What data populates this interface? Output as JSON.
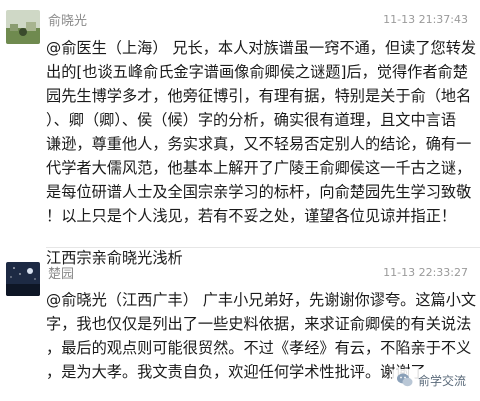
{
  "messages": [
    {
      "sender": "俞晓光",
      "time": "11-13 21:37:43",
      "avatar_icon": "landscape-avatar-icon",
      "lines": [
        "@俞医生（上海） 兄长，本人对族谱虽一窍不通，但读了您转发",
        "出的[也谈五峰俞氏金字谱画像俞卿侯之谜题]后，觉得作者俞楚",
        "园先生博学多才，他旁征博引，有理有据，特别是关于俞（地名",
        "）、卿（卿）、侯（候）字的分析，确实很有道理，且文中言语",
        "谦逊，尊重他人，务实求真，又不轻易否定别人的结论，确有一",
        "代学者大儒风范，他基本上解开了广陵王俞卿侯这一千古之谜，",
        "是每位研谱人士及全国宗亲学习的标杆，向俞楚园先生学习致敬",
        "！以上只是个人浅见，若有不妥之处，谨望各位见谅并指正！"
      ],
      "signature": "江西宗亲俞晓光浅析"
    },
    {
      "sender": "楚园",
      "time": "11-13 22:33:27",
      "avatar_icon": "night-sky-avatar-icon",
      "lines": [
        "@俞晓光（江西广丰） 广丰小兄弟好，先谢谢你谬夸。这篇小文",
        "字，我也仅仅是列出了一些史料依据，来求证俞卿侯的有关说法",
        "，最后的观点则可能很贸然。不过《孝经》有云，不陷亲于不义",
        "，是为大孝。我文责自负，欢迎任何学术性批评。谢谢了"
      ]
    }
  ],
  "watermark": {
    "label": "俞学交流",
    "icon": "wechat-logo-icon"
  }
}
